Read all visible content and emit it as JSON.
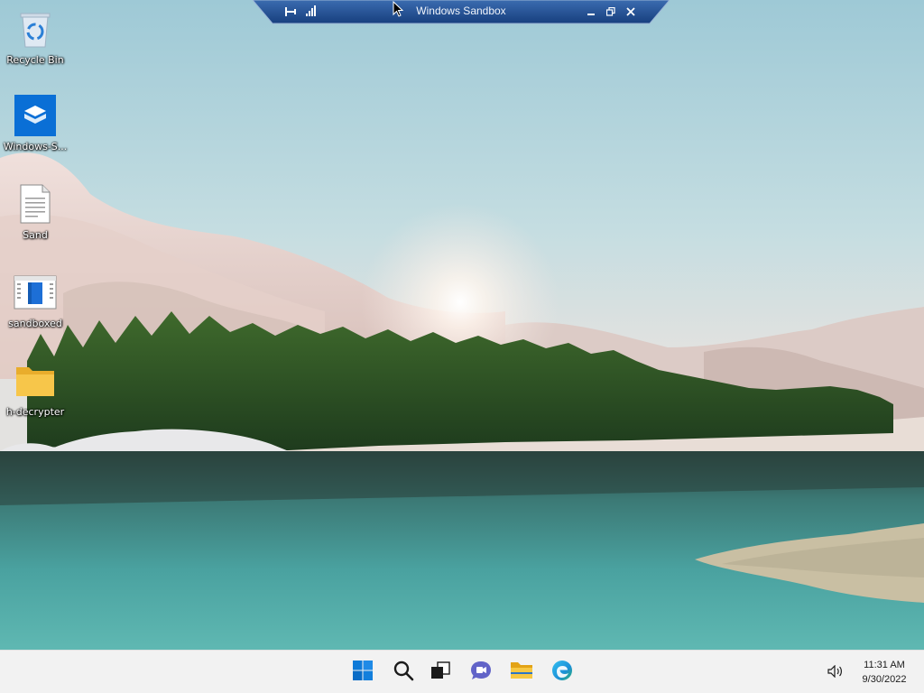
{
  "window": {
    "title": "Windows Sandbox"
  },
  "desktop": {
    "icons": [
      {
        "label": "Recycle Bin",
        "icon": "recycle-bin-icon"
      },
      {
        "label": "Windows-S...",
        "icon": "windows-sandbox-icon"
      },
      {
        "label": "Sand",
        "icon": "text-document-icon"
      },
      {
        "label": "sandboxed",
        "icon": "application-window-icon"
      },
      {
        "label": "h-decrypter",
        "icon": "folder-icon"
      }
    ]
  },
  "sandbox_bar": {
    "buttons": [
      "pin-icon",
      "connection-signal-icon",
      "minimize-icon",
      "restore-icon",
      "close-icon"
    ]
  },
  "taskbar": {
    "apps": [
      "start-icon",
      "search-icon",
      "task-view-icon",
      "chat-icon",
      "file-explorer-icon",
      "edge-icon"
    ],
    "tray": {
      "volume_icon": "volume-icon"
    },
    "clock": {
      "time": "11:31 AM",
      "date": "9/30/2022"
    }
  },
  "colors": {
    "taskbar_bg": "#f2f2f2",
    "pill_bg": "#1f4f96",
    "start_blue": "#0078d4",
    "folder_yellow": "#f6c143"
  }
}
